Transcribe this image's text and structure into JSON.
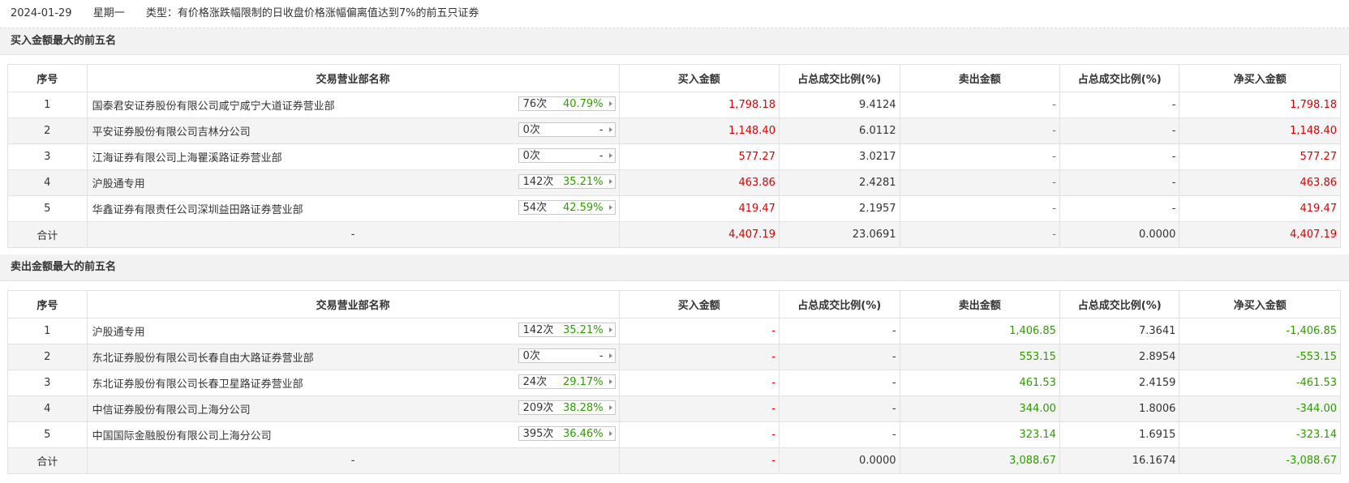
{
  "header": {
    "date": "2024-01-29",
    "weekday": "星期一",
    "type_text": "类型：有价格涨跌幅限制的日收盘价格涨幅偏离值达到7%的前五只证券"
  },
  "columns": [
    "序号",
    "交易营业部名称",
    "买入金额",
    "占总成交比例(%)",
    "卖出金额",
    "占总成交比例(%)",
    "净买入金额"
  ],
  "buy_section": {
    "title": "买入金额最大的前五名",
    "rows": [
      {
        "no": "1",
        "name": "国泰君安证券股份有限公司咸宁咸宁大道证券营业部",
        "count": "76次",
        "pct": "40.79%",
        "buy": "1,798.18",
        "buy_ratio": "9.4124",
        "sell": "-",
        "sell_ratio": "-",
        "net": "1,798.18"
      },
      {
        "no": "2",
        "name": "平安证券股份有限公司吉林分公司",
        "count": "0次",
        "pct": "-",
        "buy": "1,148.40",
        "buy_ratio": "6.0112",
        "sell": "-",
        "sell_ratio": "-",
        "net": "1,148.40"
      },
      {
        "no": "3",
        "name": "江海证券有限公司上海瞿溪路证券营业部",
        "count": "0次",
        "pct": "-",
        "buy": "577.27",
        "buy_ratio": "3.0217",
        "sell": "-",
        "sell_ratio": "-",
        "net": "577.27"
      },
      {
        "no": "4",
        "name": "沪股通专用",
        "count": "142次",
        "pct": "35.21%",
        "buy": "463.86",
        "buy_ratio": "2.4281",
        "sell": "-",
        "sell_ratio": "-",
        "net": "463.86"
      },
      {
        "no": "5",
        "name": "华鑫证券有限责任公司深圳益田路证券营业部",
        "count": "54次",
        "pct": "42.59%",
        "buy": "419.47",
        "buy_ratio": "2.1957",
        "sell": "-",
        "sell_ratio": "-",
        "net": "419.47"
      }
    ],
    "total": {
      "label": "合计",
      "name": "-",
      "buy": "4,407.19",
      "buy_ratio": "23.0691",
      "sell": "-",
      "sell_ratio": "0.0000",
      "net": "4,407.19"
    }
  },
  "sell_section": {
    "title": "卖出金额最大的前五名",
    "rows": [
      {
        "no": "1",
        "name": "沪股通专用",
        "count": "142次",
        "pct": "35.21%",
        "buy": "-",
        "buy_ratio": "-",
        "sell": "1,406.85",
        "sell_ratio": "7.3641",
        "net": "-1,406.85"
      },
      {
        "no": "2",
        "name": "东北证券股份有限公司长春自由大路证券营业部",
        "count": "0次",
        "pct": "-",
        "buy": "-",
        "buy_ratio": "-",
        "sell": "553.15",
        "sell_ratio": "2.8954",
        "net": "-553.15"
      },
      {
        "no": "3",
        "name": "东北证券股份有限公司长春卫星路证券营业部",
        "count": "24次",
        "pct": "29.17%",
        "buy": "-",
        "buy_ratio": "-",
        "sell": "461.53",
        "sell_ratio": "2.4159",
        "net": "-461.53"
      },
      {
        "no": "4",
        "name": "中信证券股份有限公司上海分公司",
        "count": "209次",
        "pct": "38.28%",
        "buy": "-",
        "buy_ratio": "-",
        "sell": "344.00",
        "sell_ratio": "1.8006",
        "net": "-344.00"
      },
      {
        "no": "5",
        "name": "中国国际金融股份有限公司上海分公司",
        "count": "395次",
        "pct": "36.46%",
        "buy": "-",
        "buy_ratio": "-",
        "sell": "323.14",
        "sell_ratio": "1.6915",
        "net": "-323.14"
      }
    ],
    "total": {
      "label": "合计",
      "name": "-",
      "buy": "-",
      "buy_ratio": "0.0000",
      "sell": "3,088.67",
      "sell_ratio": "16.1674",
      "net": "-3,088.67"
    }
  },
  "colors": {
    "buy": "#e10000",
    "sell": "#2f9c00",
    "stripe": "#f4f4f4"
  }
}
